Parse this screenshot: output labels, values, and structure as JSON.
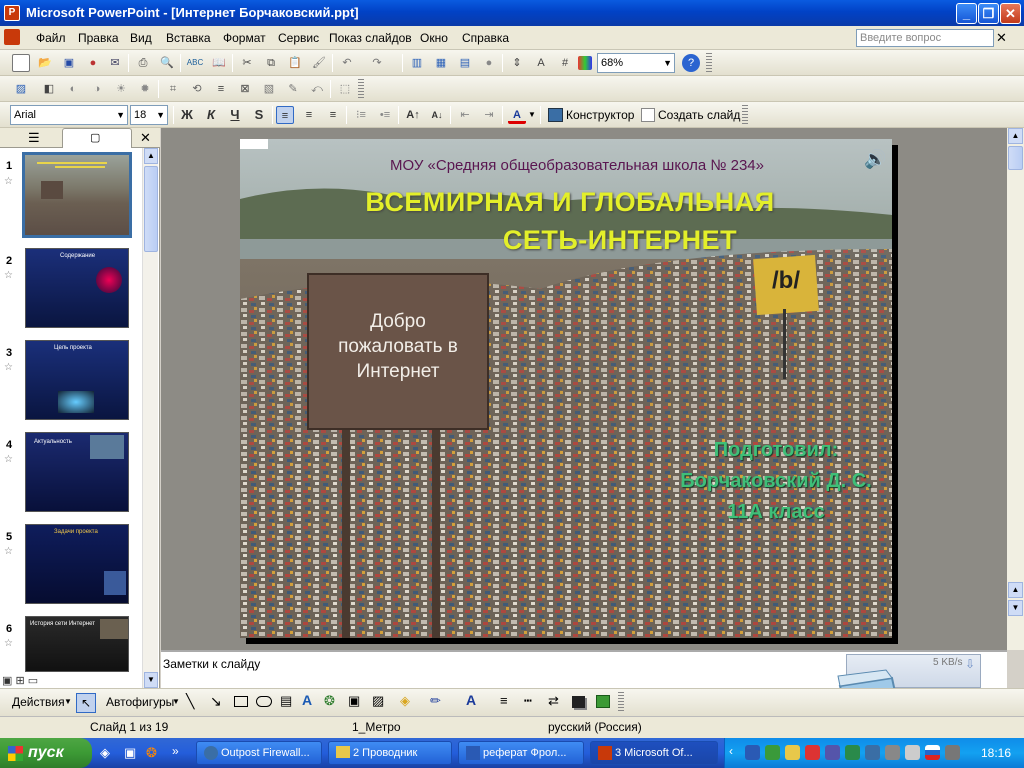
{
  "window": {
    "title": "Microsoft PowerPoint - [Интернет Борчаковский.ppt]",
    "app_icon_glyph": "P"
  },
  "menu": {
    "items": [
      "Файл",
      "Правка",
      "Вид",
      "Вставка",
      "Формат",
      "Сервис",
      "Показ слайдов",
      "Окно",
      "Справка"
    ],
    "help_placeholder": "Введите вопрос"
  },
  "toolbar": {
    "zoom": "68%",
    "font": "Arial",
    "size": "18",
    "designer_label": "Конструктор",
    "new_slide_label": "Создать слайд",
    "bold": "Ж",
    "italic": "К",
    "underline": "Ч",
    "shadow": "S"
  },
  "thumbnails": [
    {
      "num": "1",
      "selected": true
    },
    {
      "num": "2",
      "title": "Содержание",
      "bg": "#1b2f7a"
    },
    {
      "num": "3",
      "title": "Цель проекта",
      "bg": "#1a2f7a"
    },
    {
      "num": "4",
      "title": "Актуальность",
      "bg": "#1b2a70"
    },
    {
      "num": "5",
      "title": "Задачи проекта",
      "bg": "#0f1d5c"
    },
    {
      "num": "6",
      "title": "История сети Интернет",
      "bg": "#161616"
    }
  ],
  "slide": {
    "school": "МОУ «Средняя общеобразовательная школа № 234»",
    "title_line1": "ВСЕМИРНАЯ И ГЛОБАЛЬНАЯ",
    "title_line2": "СЕТЬ-ИНТЕРНЕТ",
    "sign_text": "Добро пожаловать в Интернет",
    "sign_small": "/b/",
    "author_line1": "Подготовил:",
    "author_line2": "Борчаковский Д. С.",
    "author_line3": "11А класс"
  },
  "notes": {
    "placeholder": "Заметки к слайду",
    "net_speed": "5 KB/s"
  },
  "drawing": {
    "actions": "Действия",
    "autoshapes": "Автофигуры"
  },
  "status": {
    "slide_count": "Слайд 1 из 19",
    "design": "1_Метро",
    "language": "русский (Россия)"
  },
  "taskbar": {
    "start": "пуск",
    "apps": [
      "Outpost Firewall...",
      "2 Проводник",
      "реферат Фрол...",
      "3 Microsoft Of..."
    ],
    "clock": "18:16"
  },
  "colors": {
    "title_yellow": "#e3ef2a",
    "author_green": "#3fbf78",
    "school_purple": "#5a1650",
    "xp_blue": "#0a5be0"
  }
}
